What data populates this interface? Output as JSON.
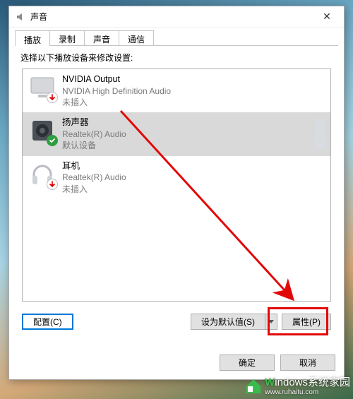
{
  "window": {
    "title": "声音",
    "close_glyph": "✕"
  },
  "tabs": [
    {
      "label": "播放",
      "active": true
    },
    {
      "label": "录制",
      "active": false
    },
    {
      "label": "声音",
      "active": false
    },
    {
      "label": "通信",
      "active": false
    }
  ],
  "panel": {
    "instruction": "选择以下播放设备来修改设置:",
    "devices": [
      {
        "name": "NVIDIA Output",
        "driver": "NVIDIA High Definition Audio",
        "status": "未插入",
        "selected": false,
        "badge": "down",
        "icon": "monitor"
      },
      {
        "name": "扬声器",
        "driver": "Realtek(R) Audio",
        "status": "默认设备",
        "selected": true,
        "badge": "check",
        "icon": "speaker"
      },
      {
        "name": "耳机",
        "driver": "Realtek(R) Audio",
        "status": "未插入",
        "selected": false,
        "badge": "down",
        "icon": "headphone"
      }
    ],
    "configure_label": "配置(C)",
    "setdefault_label": "设为默认值(S)",
    "properties_label": "属性(P)"
  },
  "dialog_buttons": {
    "ok": "确定",
    "cancel": "取消"
  },
  "watermark": {
    "text": "indows系统家园",
    "url": "www.ruhaitu.com"
  }
}
